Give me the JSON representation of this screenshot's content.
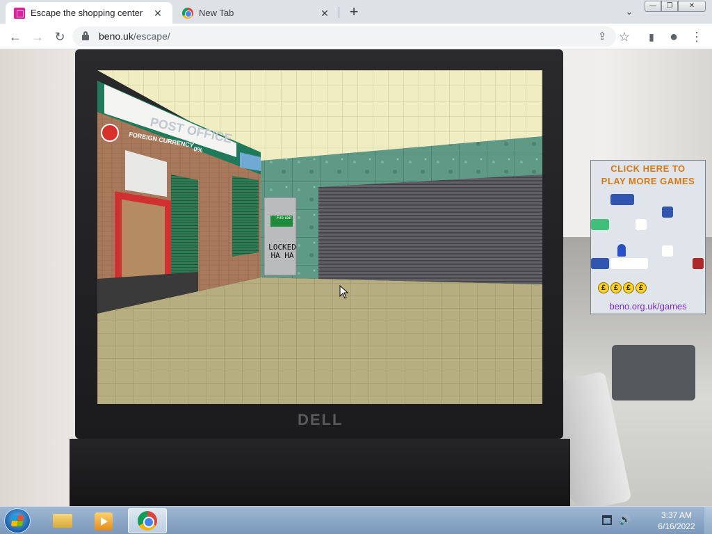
{
  "browser": {
    "tabs": [
      {
        "title": "Escape the shopping center",
        "active": true,
        "close_glyph": "✕"
      },
      {
        "title": "New Tab",
        "active": false,
        "close_glyph": "✕"
      }
    ],
    "new_tab_glyph": "+",
    "tab_search_glyph": "⌄",
    "window_controls": {
      "minimize": "—",
      "maximize": "❐",
      "close": "✕"
    },
    "toolbar": {
      "back_glyph": "←",
      "forward_glyph": "→",
      "reload_glyph": "↻",
      "share_glyph": "⇪",
      "bookmark_glyph": "☆",
      "side_panel_glyph": "▮",
      "profile_glyph": "●",
      "menu_glyph": "⋮"
    },
    "url": {
      "host": "beno.uk",
      "path": "/escape/"
    }
  },
  "game": {
    "store_sign": "POST OFFICE",
    "currency_sign": "FOREIGN CURRENCY",
    "currency_rate": "0%",
    "fire_exit_sign": "Fire exit",
    "graffiti_line1": "LOCKED",
    "graffiti_line2": "HA HA"
  },
  "laptop": {
    "brand": "DELL"
  },
  "ad": {
    "headline_line1": "CLICK HERE TO",
    "headline_line2": "PLAY MORE GAMES",
    "coin_symbol": "£",
    "link_text": "beno.org.uk/games"
  },
  "taskbar": {
    "time": "3:37 AM",
    "date": "6/16/2022",
    "volume_glyph": "🔊"
  },
  "colors": {
    "ad_headline": "#d47a14",
    "ad_link": "#7a2ad0",
    "post_office_green": "#1e7a5a",
    "shutter_gray": "#5a5a5e"
  }
}
